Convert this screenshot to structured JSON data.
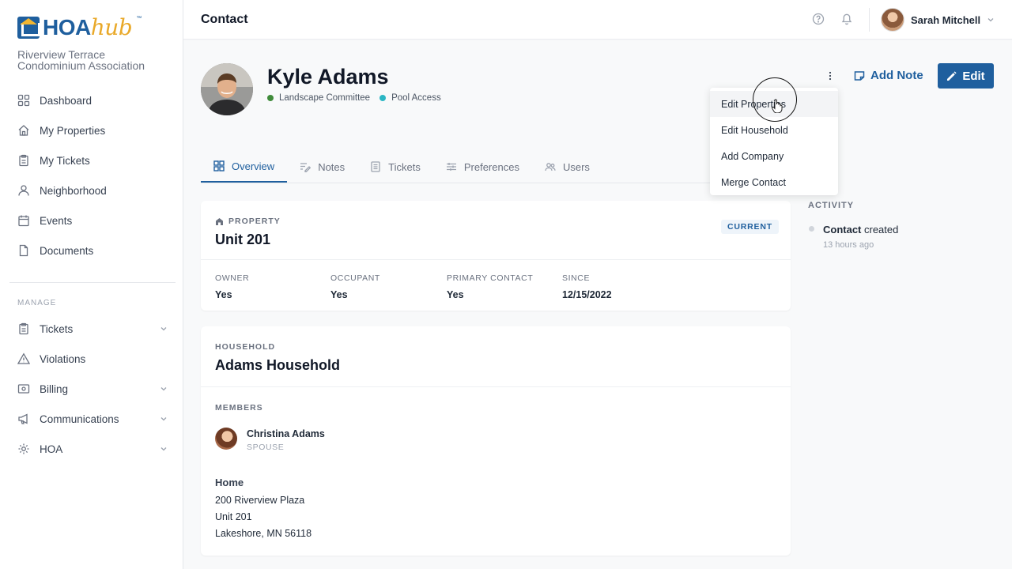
{
  "brand": {
    "logo_hoa": "HOA",
    "logo_hub": "hub",
    "logo_tm": "™",
    "association": "Riverview Terrace Condominium Association"
  },
  "sidebar": {
    "items": [
      {
        "label": "Dashboard",
        "icon": "dashboard-icon"
      },
      {
        "label": "My Properties",
        "icon": "home-icon"
      },
      {
        "label": "My Tickets",
        "icon": "clipboard-icon"
      },
      {
        "label": "Neighborhood",
        "icon": "people-icon"
      },
      {
        "label": "Events",
        "icon": "calendar-icon"
      },
      {
        "label": "Documents",
        "icon": "document-icon"
      }
    ],
    "manage_label": "MANAGE",
    "manage_items": [
      {
        "label": "Tickets",
        "icon": "clipboard-icon",
        "expandable": true
      },
      {
        "label": "Violations",
        "icon": "warning-icon",
        "expandable": false
      },
      {
        "label": "Billing",
        "icon": "billing-icon",
        "expandable": true
      },
      {
        "label": "Communications",
        "icon": "megaphone-icon",
        "expandable": true
      },
      {
        "label": "HOA",
        "icon": "gear-icon",
        "expandable": true
      }
    ]
  },
  "topbar": {
    "title": "Contact",
    "user_name": "Sarah Mitchell"
  },
  "contact": {
    "name": "Kyle Adams",
    "tags": [
      {
        "label": "Landscape Committee",
        "color": "#3f8b3a"
      },
      {
        "label": "Pool Access",
        "color": "#2bb6c4"
      }
    ]
  },
  "actions": {
    "add_note": "Add Note",
    "edit": "Edit"
  },
  "dropdown": {
    "items": [
      "Edit Properties",
      "Edit Household",
      "Add Company",
      "Merge Contact"
    ]
  },
  "tabs": [
    "Overview",
    "Notes",
    "Tickets",
    "Preferences",
    "Users"
  ],
  "property": {
    "label": "PROPERTY",
    "title": "Unit 201",
    "badge": "CURRENT",
    "fields": [
      {
        "label": "OWNER",
        "value": "Yes"
      },
      {
        "label": "OCCUPANT",
        "value": "Yes"
      },
      {
        "label": "PRIMARY CONTACT",
        "value": "Yes"
      },
      {
        "label": "SINCE",
        "value": "12/15/2022"
      }
    ]
  },
  "household": {
    "label": "HOUSEHOLD",
    "title": "Adams Household",
    "members_label": "MEMBERS",
    "member": {
      "name": "Christina Adams",
      "role": "SPOUSE"
    },
    "address_label": "Home",
    "address_lines": [
      "200 Riverview Plaza",
      "Unit 201",
      "Lakeshore, MN 56118"
    ]
  },
  "activity": {
    "title": "ACTIVITY",
    "item_bold": "Contact",
    "item_rest": " created",
    "time": "13 hours ago"
  },
  "colors": {
    "primary": "#1f5f9e",
    "accent": "#e9a92a"
  }
}
